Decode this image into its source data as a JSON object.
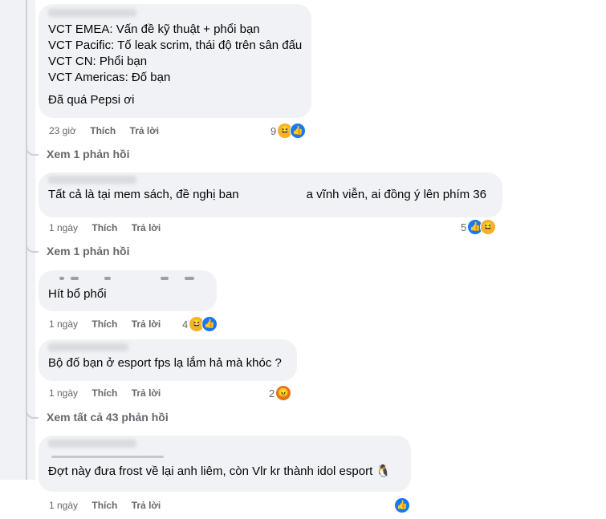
{
  "comments": [
    {
      "lines": [
        "VCT EMEA: Vấn đề kỹ thuật + phổi bạn",
        "VCT Pacific: Tố leak scrim, thái độ trên sân đấu",
        "VCT CN: Phổi bạn",
        "VCT Americas: Đố bạn"
      ],
      "extra": "Đã quá Pepsi ơi",
      "time": "23 giờ",
      "like": "Thích",
      "reply": "Trả lời",
      "reaction_count": "9",
      "reactions": [
        "haha-icon",
        "like-icon"
      ]
    },
    {
      "text_before": "Tất cả là tại mem sách, đề nghị ban",
      "text_after": "a vĩnh viễn, ai đồng ý lên phím 36",
      "time": "1 ngày",
      "like": "Thích",
      "reply": "Trả lời",
      "reaction_count": "5",
      "reactions": [
        "like-icon",
        "haha-icon"
      ]
    },
    {
      "text": "Hít bổ phổi",
      "time": "1 ngày",
      "like": "Thích",
      "reply": "Trả lời",
      "reaction_count": "4",
      "reactions": [
        "haha-icon",
        "like-icon"
      ]
    },
    {
      "text": "Bộ đố bạn ở esport fps lạ lắm hả mà khóc ?",
      "time": "1 ngày",
      "like": "Thích",
      "reply": "Trả lời",
      "reaction_count": "2",
      "reactions": [
        "angry-icon"
      ]
    },
    {
      "text": "Đợt này đưa frost về lại anh liêm, còn Vlr kr thành idol esport 🐧",
      "time": "1 ngày",
      "like": "Thích",
      "reply": "Trả lời",
      "reaction_count": "",
      "reactions": [
        "like-icon"
      ]
    }
  ],
  "view_replies": [
    "Xem 1 phản hồi",
    "Xem 1 phản hồi",
    "Xem tất cả 43 phản hồi"
  ],
  "colors": {
    "like": "#1877f2",
    "haha": "#f7b125",
    "angry": "#e9710f",
    "bubble": "#f0f2f5",
    "meta": "#65676b"
  }
}
